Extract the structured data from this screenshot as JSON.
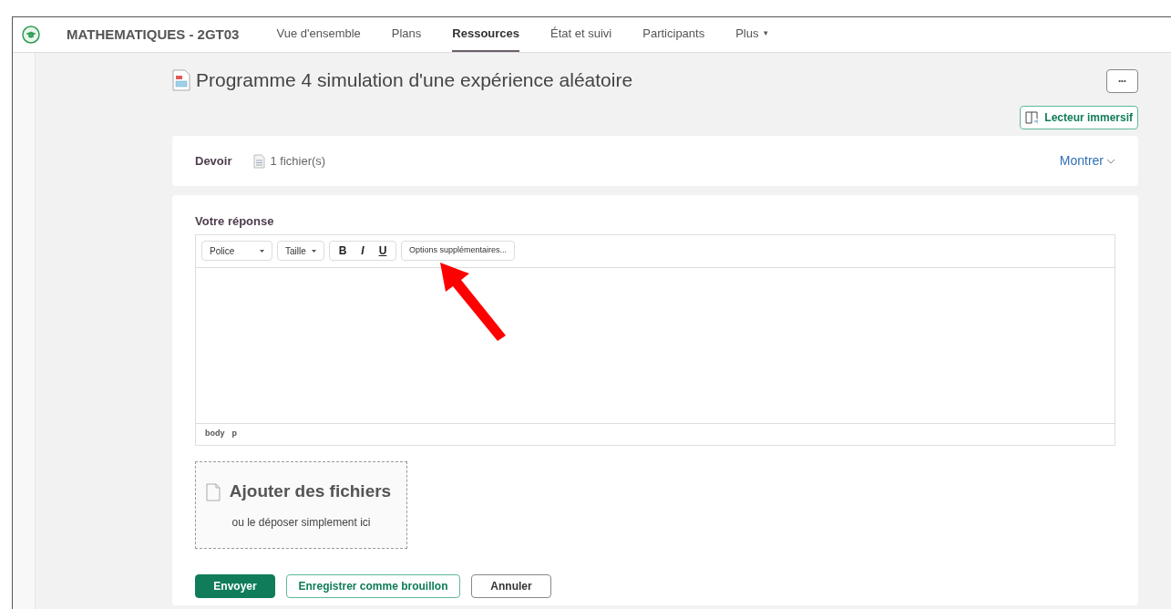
{
  "course": {
    "title": "MATHEMATIQUES - 2GT03"
  },
  "tabs": [
    {
      "label": "Vue d'ensemble",
      "selected": false
    },
    {
      "label": "Plans",
      "selected": false
    },
    {
      "label": "Ressources",
      "selected": true
    },
    {
      "label": "État et suivi",
      "selected": false
    },
    {
      "label": "Participants",
      "selected": false
    },
    {
      "label": "Plus",
      "selected": false,
      "kind": "menu",
      "caret": "▾"
    }
  ],
  "page": {
    "title": "Programme 4 simulation d'une expérience aléatoire",
    "more_button": "•••",
    "immersive_reader": "Lecteur immersif"
  },
  "assignment": {
    "label": "Devoir",
    "files": "1 fichier(s)",
    "toggle": "Montrer"
  },
  "response": {
    "label": "Votre réponse",
    "toolbar": {
      "font": "Police",
      "size": "Taille",
      "bold": "B",
      "italic": "I",
      "underline": "U",
      "more": "Options supplémentaires..."
    },
    "path": [
      "body",
      "p"
    ]
  },
  "upload": {
    "title": "Ajouter des fichiers",
    "hint": "ou le déposer simplement ici"
  },
  "buttons": [
    {
      "label": "Envoyer",
      "kind": "primary"
    },
    {
      "label": "Enregistrer comme brouillon",
      "kind": "secondary"
    },
    {
      "label": "Annuler",
      "kind": "plain"
    }
  ]
}
